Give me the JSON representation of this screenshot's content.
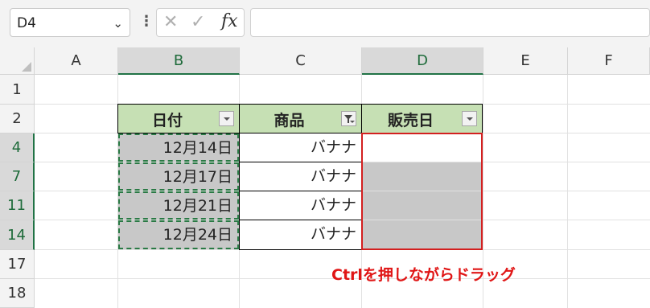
{
  "name_box": {
    "value": "D4"
  },
  "formula_bar": {
    "cancel_glyph": "✕",
    "enter_glyph": "✓",
    "fx_label": "fx",
    "value": ""
  },
  "columns": [
    "A",
    "B",
    "C",
    "D",
    "E",
    "F"
  ],
  "rows": [
    "1",
    "2",
    "4",
    "7",
    "11",
    "14",
    "17",
    "18"
  ],
  "table": {
    "headers": [
      "日付",
      "商品",
      "販売日"
    ],
    "dates": [
      "12月14日",
      "12月17日",
      "12月21日",
      "12月24日"
    ],
    "products": [
      "バナナ",
      "バナナ",
      "バナナ",
      "バナナ"
    ]
  },
  "annotation": "Ctrlを押しながらドラッグ",
  "colors": {
    "header_fill": "#c6e0b4",
    "selection_green": "#217346",
    "annotation_red": "#e01515",
    "filtered_row_blue": "#2b4bd0"
  }
}
